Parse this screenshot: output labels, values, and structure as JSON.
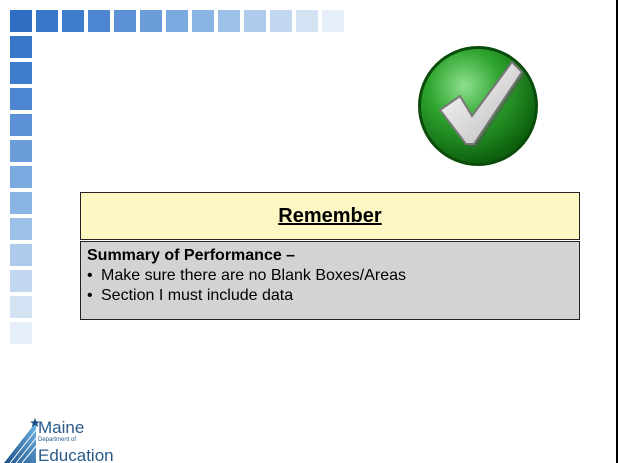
{
  "remember": {
    "title": "Remember",
    "subtitle": "Summary of Performance –",
    "bullets": [
      "Make sure there are no Blank Boxes/Areas",
      "Section I must include data"
    ]
  },
  "logo": {
    "line1": "Maine",
    "line2": "Department of",
    "line3": "Education"
  },
  "icons": {
    "check": "green-checkmark-icon"
  },
  "colors": {
    "square_blue": "#3a78c9",
    "header_fill": "#fdf7c3",
    "body_fill": "#d3d3d3",
    "check_green": "#2a9a2a"
  }
}
